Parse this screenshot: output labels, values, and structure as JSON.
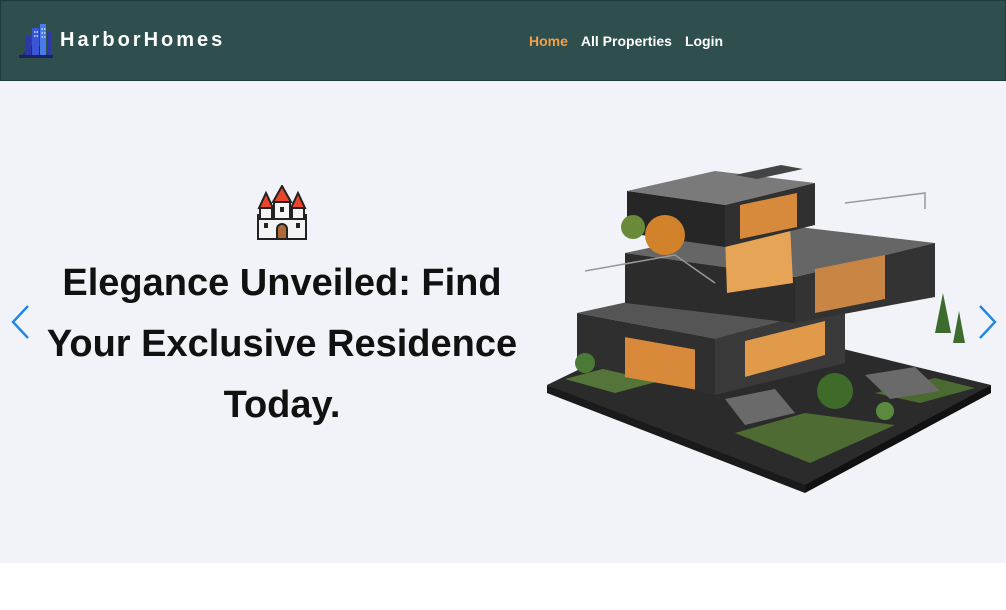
{
  "header": {
    "brand_name": "HarborHomes",
    "logo_icon": "city-buildings-icon",
    "nav": [
      {
        "label": "Home",
        "active": true
      },
      {
        "label": "All Properties",
        "active": false
      },
      {
        "label": "Login",
        "active": false
      }
    ],
    "colors": {
      "background": "#2f4f4f",
      "active_link": "#f0a048",
      "link": "#ffffff"
    }
  },
  "hero": {
    "emoji_icon": "castle-icon",
    "headline": "Elegance Unveiled: Find Your Exclusive Residence Today.",
    "image": "modern-house-illustration",
    "prev_icon": "chevron-left-icon",
    "next_icon": "chevron-right-icon",
    "colors": {
      "background": "#f2f3f8",
      "arrow": "#1e88e5",
      "headline": "#111111"
    }
  }
}
